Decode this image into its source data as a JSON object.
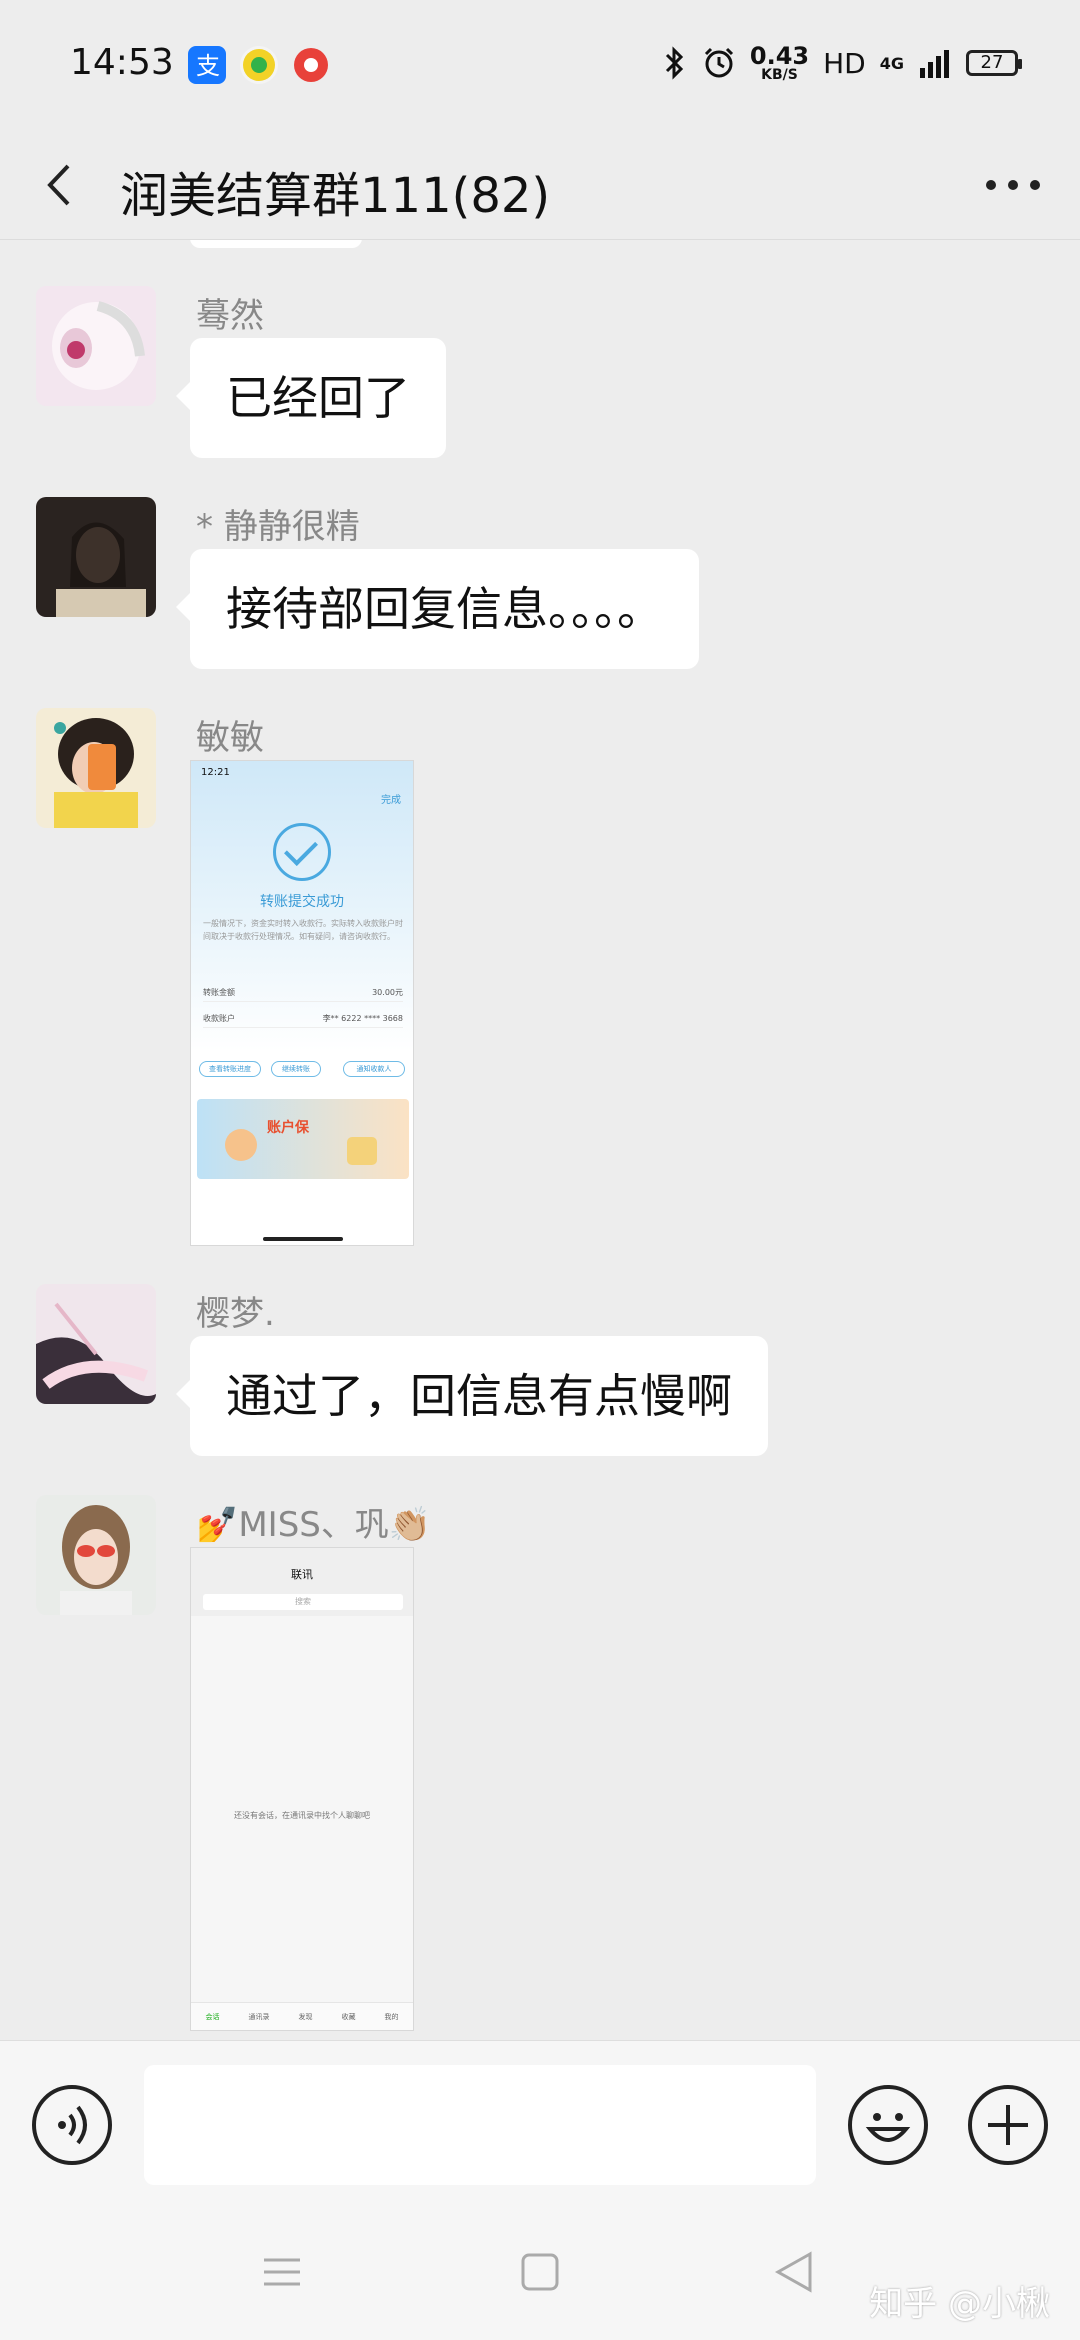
{
  "status_bar": {
    "time": "14:53",
    "network_speed_value": "0.43",
    "network_speed_unit": "KB/S",
    "hd": "HD",
    "net_type": "4G",
    "battery": "27",
    "app_icons": [
      "alipay-icon",
      "app-icon-yellow",
      "app-icon-red"
    ]
  },
  "nav": {
    "title": "润美结算群111(82)"
  },
  "messages": [
    {
      "sender": "蓦然",
      "type": "text",
      "text": "已经回了"
    },
    {
      "sender": "* 静静很精",
      "type": "text",
      "text": "接待部回复信息。。。。"
    },
    {
      "sender": "敏敏",
      "type": "image",
      "image": "transfer-success-screenshot"
    },
    {
      "sender": "樱梦.",
      "type": "text",
      "text": "通过了，回信息有点慢啊"
    },
    {
      "sender": "💅MISS、巩👏🏼",
      "type": "image",
      "image": "contacts-screenshot"
    }
  ],
  "shot1": {
    "time": "12:21",
    "done": "完成",
    "title": "转账提交成功",
    "desc": "一般情况下，资金实时转入收款行。实际转入收款账户时间取决于收款行处理情况。如有疑问，请咨询收款行。",
    "amount_label": "转账金额",
    "amount_value": "30.00元",
    "account_label": "收款账户",
    "account_value": "李**  6222 **** 3668",
    "btn1": "查看转账进度",
    "btn2": "继续转账",
    "btn3": "通知收款人",
    "banner": "账户保"
  },
  "shot2": {
    "title": "联讯",
    "search": "搜索",
    "empty": "还没有会话，在通讯录中找个人聊聊吧",
    "tabs": [
      "会话",
      "通讯录",
      "发现",
      "收藏",
      "我的"
    ]
  },
  "watermark": "知乎 @小楸"
}
